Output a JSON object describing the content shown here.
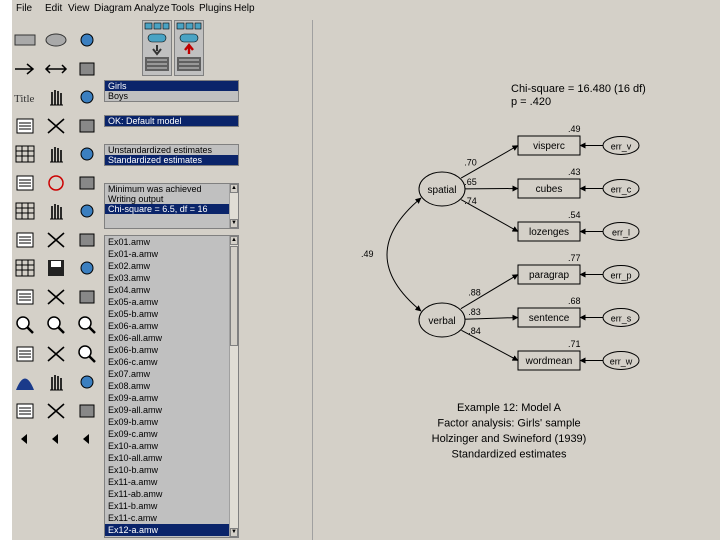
{
  "menubar": {
    "items": [
      "File",
      "Edit",
      "View",
      "Diagram",
      "Analyze",
      "Tools",
      "Plugins",
      "Help"
    ]
  },
  "icons": {
    "toolbox": [
      "rectangle-icon",
      "ellipse-icon",
      "indicator-icon",
      "path-arrow-icon",
      "covariance-arrow-icon",
      "unique-variable-icon",
      "title-icon",
      "variable-list-icon",
      "data-set-list-icon",
      "select-one-icon",
      "select-all-icon",
      "deselect-all-icon",
      "duplicate-icon",
      "move-icon",
      "erase-icon",
      "shape-change-icon",
      "rotate-icon",
      "reflect-icon",
      "move-parameter-icon",
      "scroll-icon",
      "touch-up-icon",
      "data-file-icon",
      "analysis-properties-icon",
      "calculate-estimates-icon",
      "view-text-icon",
      "save-icon",
      "print-icon",
      "object-properties-icon",
      "drag-properties-icon",
      "preserve-symmetry-icon",
      "zoom-in-icon",
      "zoom-icon",
      "zoom-out-icon",
      "page-view-icon",
      "fit-page-icon",
      "loupe-icon",
      "bayesian-icon",
      "multiple-group-icon",
      "specification-search-icon",
      "undo-icon",
      "redo-icon",
      "binoculars-icon",
      "small-left-arrow-icon",
      "small-left-arrow-icon",
      "small-left-arrow-icon"
    ],
    "view_input": "view-input-diagram-icon",
    "view_output": "view-output-diagram-icon"
  },
  "groups": {
    "items": [
      "Girls",
      "Boys"
    ],
    "selected": 0
  },
  "models": {
    "items": [
      "OK: Default model"
    ],
    "selected": 0
  },
  "params": {
    "items": [
      "Unstandardized estimates",
      "Standardized estimates"
    ],
    "selected": 1
  },
  "messages": {
    "items": [
      "Minimum was achieved",
      "Writing output",
      "Chi-square = 6.5, df = 16"
    ],
    "selected": 2
  },
  "files": {
    "items": [
      "Ex01.amw",
      "Ex01-a.amw",
      "Ex02.amw",
      "Ex03.amw",
      "Ex04.amw",
      "Ex05-a.amw",
      "Ex05-b.amw",
      "Ex06-a.amw",
      "Ex06-all.amw",
      "Ex06-b.amw",
      "Ex06-c.amw",
      "Ex07.amw",
      "Ex08.amw",
      "Ex09-a.amw",
      "Ex09-all.amw",
      "Ex09-b.amw",
      "Ex09-c.amw",
      "Ex10-a.amw",
      "Ex10-all.amw",
      "Ex10-b.amw",
      "Ex11-a.amw",
      "Ex11-ab.amw",
      "Ex11-b.amw",
      "Ex11-c.amw",
      "Ex12-a.amw"
    ],
    "selected": 24
  },
  "diagram": {
    "chi_line": "Chi-square = 16.480 (16 df)",
    "p_line": "p = .420",
    "latents": [
      "spatial",
      "verbal"
    ],
    "observed": [
      "visperc",
      "cubes",
      "lozenges",
      "paragrap",
      "sentence",
      "wordmean"
    ],
    "errors": [
      "err_v",
      "err_c",
      "err_l",
      "err_p",
      "err_s",
      "err_w"
    ],
    "r_squared": [
      ".49",
      ".43",
      ".54",
      ".77",
      ".68",
      ".71"
    ],
    "loadings": [
      ".70",
      ".65",
      ".74",
      ".88",
      ".83",
      ".84"
    ],
    "correlation": ".49",
    "caption": [
      "Example 12: Model A",
      "Factor analysis: Girls' sample",
      "Holzinger and Swineford (1939)",
      "Standardized estimates"
    ]
  },
  "colors": {
    "selection": "#0a246a",
    "canvas": "#d4d0c8",
    "panel": "#c0c0c0"
  }
}
